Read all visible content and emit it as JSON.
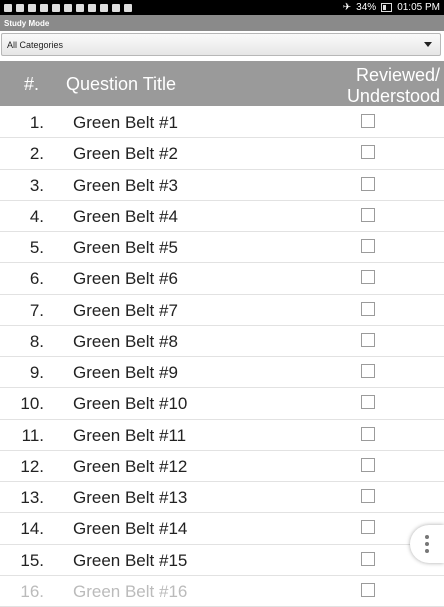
{
  "status_bar": {
    "battery": "34%",
    "time": "01:05 PM"
  },
  "title": "Study Mode",
  "category_select": {
    "selected": "All Categories"
  },
  "table": {
    "headers": {
      "number": "#.",
      "title": "Question Title",
      "reviewed_line1": "Reviewed/",
      "reviewed_line2": "Understood"
    },
    "rows": [
      {
        "num": "1.",
        "title": "Green Belt #1",
        "checked": false
      },
      {
        "num": "2.",
        "title": "Green Belt #2",
        "checked": false
      },
      {
        "num": "3.",
        "title": "Green Belt #3",
        "checked": false
      },
      {
        "num": "4.",
        "title": "Green Belt #4",
        "checked": false
      },
      {
        "num": "5.",
        "title": "Green Belt #5",
        "checked": false
      },
      {
        "num": "6.",
        "title": "Green Belt #6",
        "checked": false
      },
      {
        "num": "7.",
        "title": "Green Belt #7",
        "checked": false
      },
      {
        "num": "8.",
        "title": "Green Belt #8",
        "checked": false
      },
      {
        "num": "9.",
        "title": "Green Belt #9",
        "checked": false
      },
      {
        "num": "10.",
        "title": "Green Belt #10",
        "checked": false
      },
      {
        "num": "11.",
        "title": "Green Belt #11",
        "checked": false
      },
      {
        "num": "12.",
        "title": "Green Belt #12",
        "checked": false
      },
      {
        "num": "13.",
        "title": "Green Belt #13",
        "checked": false
      },
      {
        "num": "14.",
        "title": "Green Belt #14",
        "checked": false
      },
      {
        "num": "15.",
        "title": "Green Belt #15",
        "checked": false
      },
      {
        "num": "16.",
        "title": "Green Belt #16",
        "checked": false
      }
    ]
  },
  "icons": {
    "overflow_menu": "more-vert-icon",
    "dropdown": "chevron-down-icon"
  },
  "colors": {
    "header_bg": "#9a9a9a",
    "title_bar_bg": "#8a8a8a"
  }
}
